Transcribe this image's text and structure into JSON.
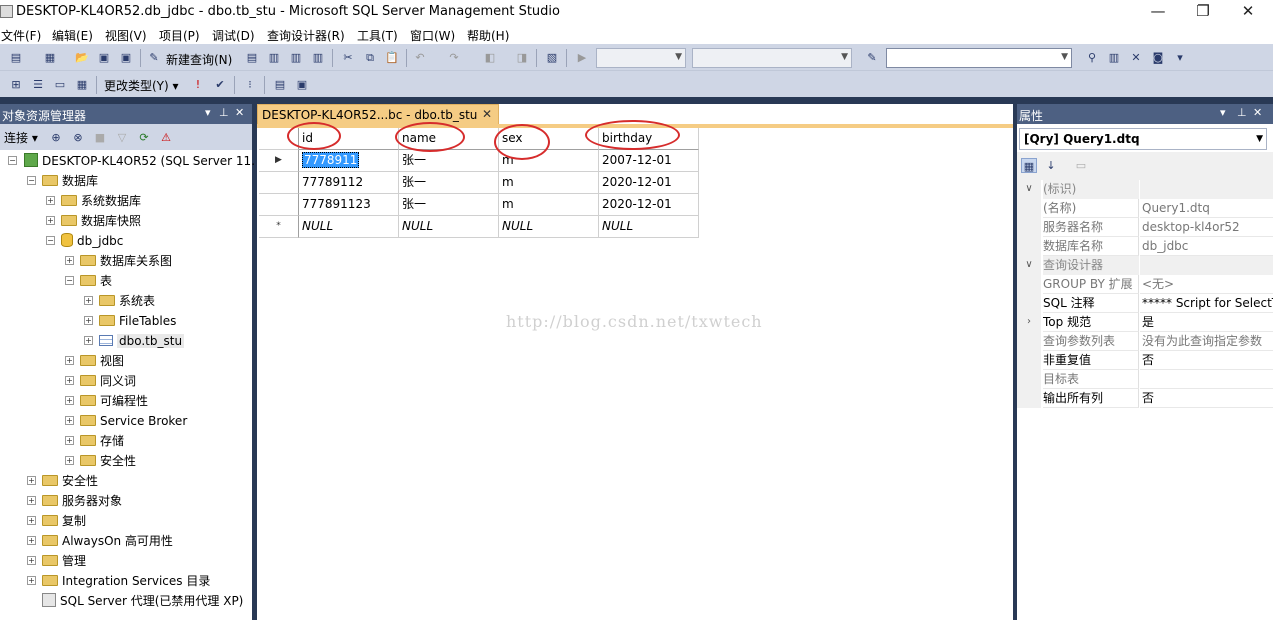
{
  "window": {
    "title": "DESKTOP-KL4OR52.db_jdbc - dbo.tb_stu - Microsoft SQL Server Management Studio"
  },
  "menu": [
    "文件(F)",
    "编辑(E)",
    "视图(V)",
    "项目(P)",
    "调试(D)",
    "查询设计器(R)",
    "工具(T)",
    "窗口(W)",
    "帮助(H)"
  ],
  "toolbar": {
    "new_query": "新建查询(N)",
    "change_type": "更改类型(Y)"
  },
  "object_explorer": {
    "title": "对象资源管理器",
    "connect": "连接",
    "nodes": {
      "server": "DESKTOP-KL4OR52 (SQL Server 11.",
      "databases": "数据库",
      "system_db": "系统数据库",
      "snapshots": "数据库快照",
      "db_jdbc": "db_jdbc",
      "diagrams": "数据库关系图",
      "tables": "表",
      "system_tables": "系统表",
      "filetables": "FileTables",
      "tb_stu": "dbo.tb_stu",
      "views": "视图",
      "synonyms": "同义词",
      "programmability": "可编程性",
      "service_broker": "Service Broker",
      "storage": "存储",
      "security_db": "安全性",
      "security": "安全性",
      "server_objects": "服务器对象",
      "replication": "复制",
      "alwayson": "AlwaysOn 高可用性",
      "management": "管理",
      "integration": "Integration Services 目录",
      "agent": "SQL Server 代理(已禁用代理 XP)"
    }
  },
  "document": {
    "tab_title": "DESKTOP-KL4OR52...bc - dbo.tb_stu",
    "columns": [
      "id",
      "name",
      "sex",
      "birthday"
    ],
    "rows": [
      [
        "7778911",
        "张一",
        "m",
        "2007-12-01"
      ],
      [
        "77789112",
        "张一",
        "m",
        "2020-12-01"
      ],
      [
        "777891123",
        "张一",
        "m",
        "2020-12-01"
      ],
      [
        "NULL",
        "NULL",
        "NULL",
        "NULL"
      ]
    ],
    "watermark": "http://blog.csdn.net/txwtech"
  },
  "properties": {
    "title": "属性",
    "selector": "[Qry] Query1.dtq",
    "rows": [
      {
        "k": "(标识)",
        "v": "",
        "cat": true
      },
      {
        "k": "(名称)",
        "v": "Query1.dtq"
      },
      {
        "k": "服务器名称",
        "v": "desktop-kl4or52"
      },
      {
        "k": "数据库名称",
        "v": "db_jdbc"
      },
      {
        "k": "查询设计器",
        "v": "",
        "cat": true
      },
      {
        "k": "GROUP BY 扩展",
        "v": "<无>"
      },
      {
        "k": "SQL 注释",
        "v": "***** Script for SelectTop"
      },
      {
        "k": "Top 规范",
        "v": "是"
      },
      {
        "k": "查询参数列表",
        "v": "没有为此查询指定参数"
      },
      {
        "k": "非重复值",
        "v": "否"
      },
      {
        "k": "目标表",
        "v": ""
      },
      {
        "k": "输出所有列",
        "v": "否"
      }
    ]
  }
}
